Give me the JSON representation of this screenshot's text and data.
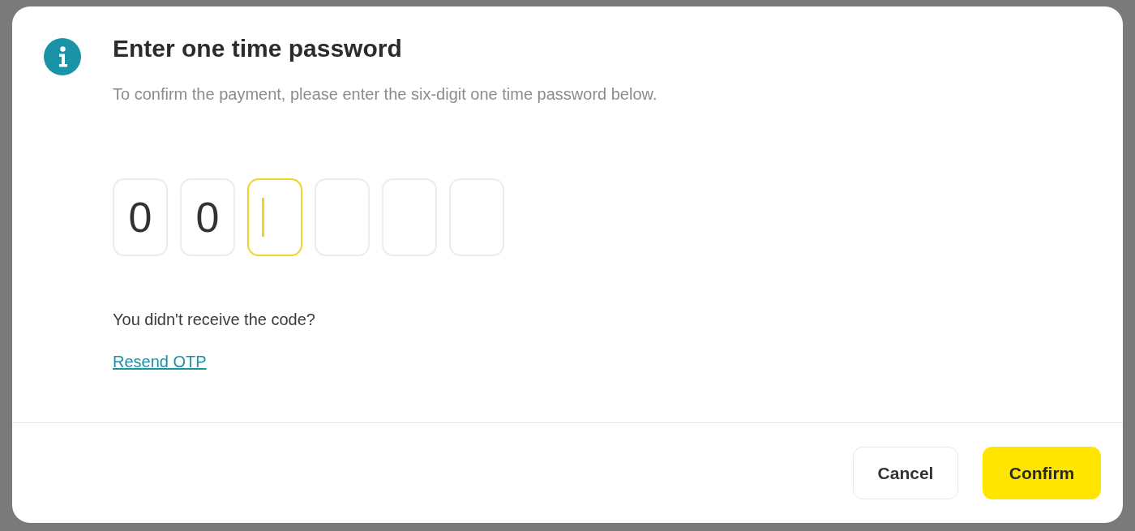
{
  "dialog": {
    "title": "Enter one time password",
    "description": "To confirm the payment, please enter the six-digit one time password below.",
    "otp_digits": [
      {
        "value": "0",
        "focused": false
      },
      {
        "value": "0",
        "focused": false
      },
      {
        "focused": true
      },
      {
        "focused": false
      },
      {
        "focused": false
      },
      {
        "focused": false
      }
    ],
    "prompt": "You didn't receive the code?",
    "resend_link": "Resend OTP",
    "buttons": [
      {
        "label": "Cancel",
        "kind": "secondary"
      },
      {
        "label": "Confirm",
        "kind": "primary"
      }
    ]
  }
}
